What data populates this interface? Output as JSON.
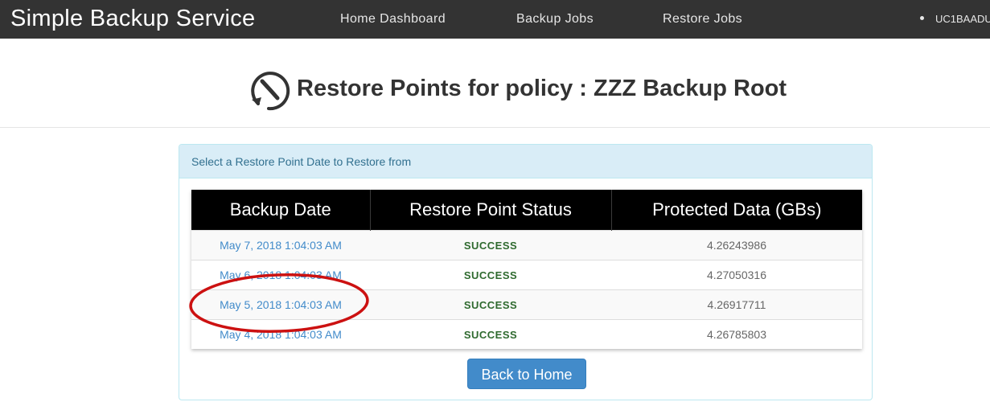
{
  "navbar": {
    "brand": "Simple Backup Service",
    "links": [
      "Home Dashboard",
      "Backup Jobs",
      "Restore Jobs"
    ],
    "user": "UC1BAADU"
  },
  "header": {
    "icon": "restore-clock-icon",
    "title": "Restore Points for policy : ZZZ Backup Root"
  },
  "panel": {
    "heading": "Select a Restore Point Date to Restore from",
    "table": {
      "columns": [
        "Backup Date",
        "Restore Point Status",
        "Protected Data (GBs)"
      ],
      "rows": [
        {
          "date": "May 7, 2018 1:04:03 AM",
          "status": "SUCCESS",
          "data": "4.26243986"
        },
        {
          "date": "May 6, 2018 1:04:03 AM",
          "status": "SUCCESS",
          "data": "4.27050316"
        },
        {
          "date": "May 5, 2018 1:04:03 AM",
          "status": "SUCCESS",
          "data": "4.26917711"
        },
        {
          "date": "May 4, 2018 1:04:03 AM",
          "status": "SUCCESS",
          "data": "4.26785803"
        }
      ]
    },
    "back_button": "Back to Home"
  },
  "colors": {
    "navbar_bg": "#333333",
    "panel_heading_bg": "#d9edf7",
    "link": "#428bca",
    "success": "#2f6a2f",
    "button": "#428bca",
    "annotation": "#cc1111"
  }
}
